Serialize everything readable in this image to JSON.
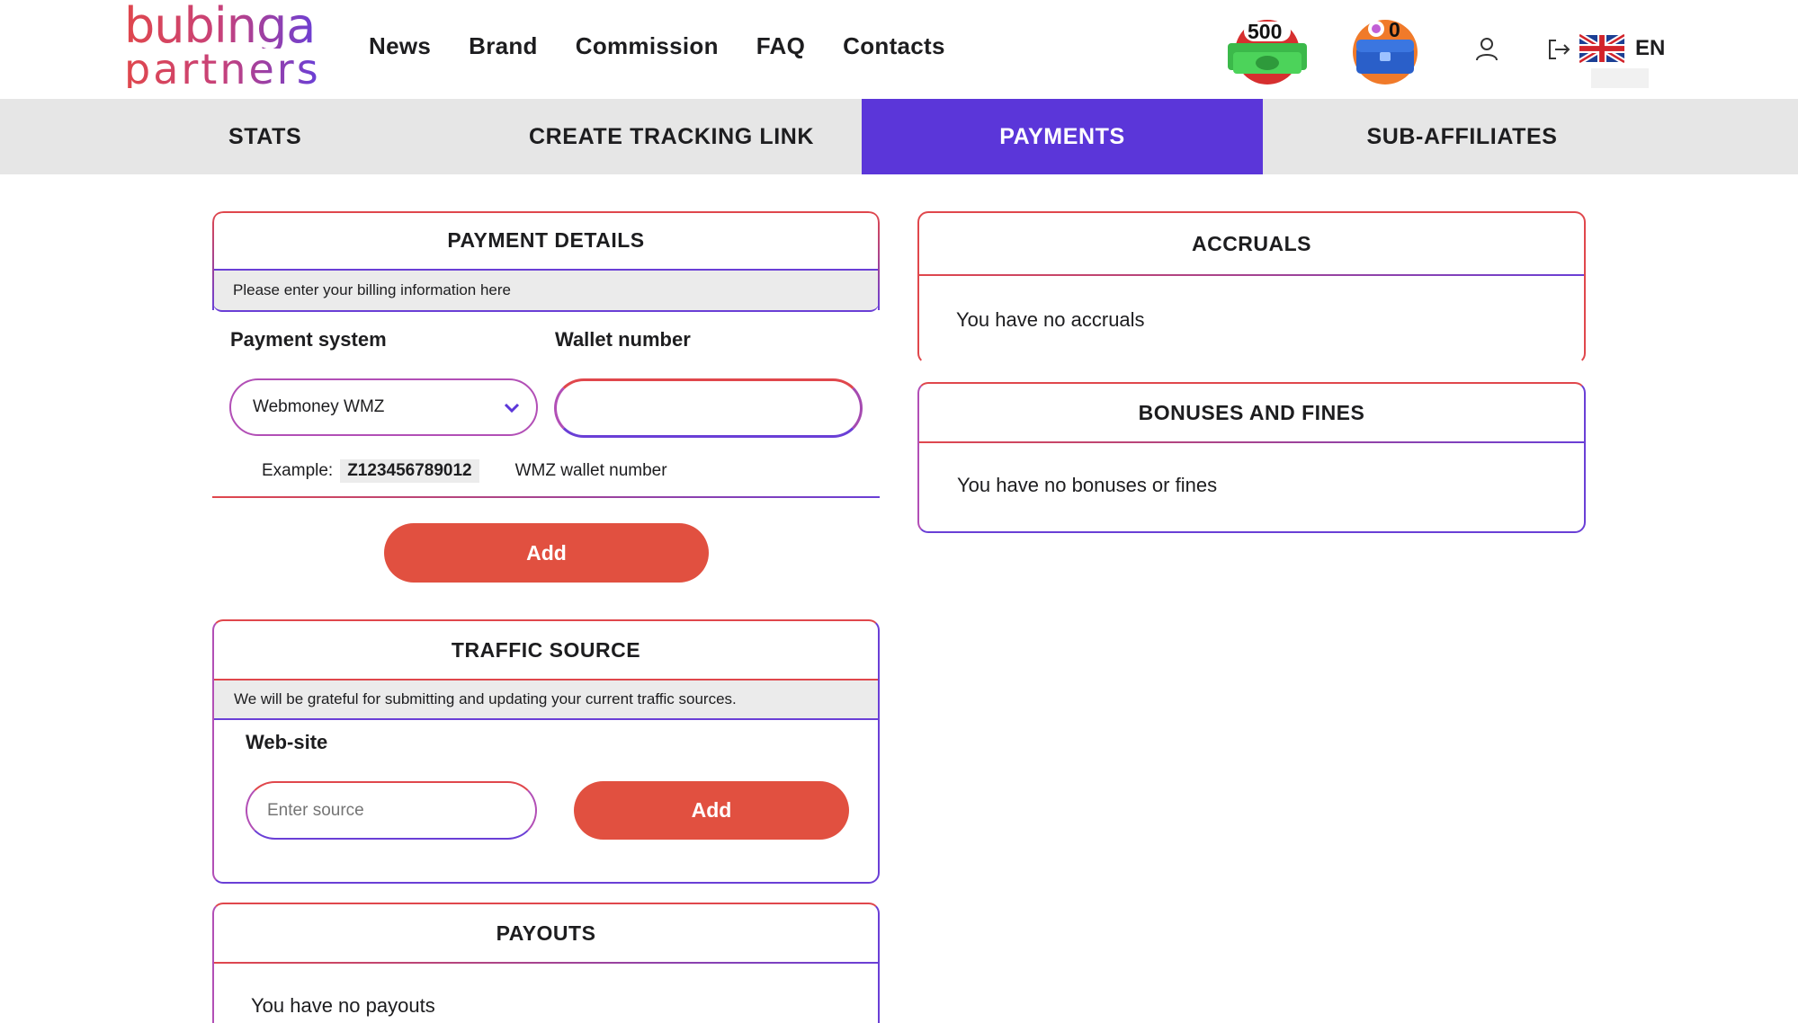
{
  "logo": {
    "line1": "bubinga",
    "line2": "partners"
  },
  "nav": [
    {
      "label": "News"
    },
    {
      "label": "Brand"
    },
    {
      "label": "Commission"
    },
    {
      "label": "FAQ"
    },
    {
      "label": "Contacts"
    }
  ],
  "header_badges": {
    "money_count": "500",
    "chest_count": "0"
  },
  "language": {
    "code": "EN",
    "flag_icon": "uk-flag-icon"
  },
  "tabs": [
    {
      "label": "STATS"
    },
    {
      "label": "CREATE TRACKING LINK"
    },
    {
      "label": "PAYMENTS"
    },
    {
      "label": "SUB-AFFILIATES"
    }
  ],
  "active_tab": "PAYMENTS",
  "payment_details": {
    "title": "PAYMENT DETAILS",
    "subtitle": "Please enter your billing information here",
    "payment_system_label": "Payment system",
    "wallet_label": "Wallet number",
    "payment_system_value": "Webmoney WMZ",
    "wallet_value": "",
    "example_label": "Example:",
    "example_value": "Z123456789012",
    "example_hint": "WMZ wallet number",
    "add_label": "Add"
  },
  "traffic_source": {
    "title": "TRAFFIC SOURCE",
    "subtitle": "We will be grateful for submitting and updating your current traffic sources.",
    "website_label": "Web-site",
    "source_placeholder": "Enter source",
    "add_label": "Add"
  },
  "payouts": {
    "title": "PAYOUTS",
    "empty": "You have no payouts"
  },
  "accruals": {
    "title": "ACCRUALS",
    "empty": "You have no accruals"
  },
  "bonuses": {
    "title": "BONUSES AND FINES",
    "empty": "You have no bonuses or fines"
  },
  "colors": {
    "accent_purple": "#5b36d9",
    "accent_red": "#e15040",
    "gradient_start": "#e0474c",
    "gradient_end": "#6a3fd6"
  }
}
